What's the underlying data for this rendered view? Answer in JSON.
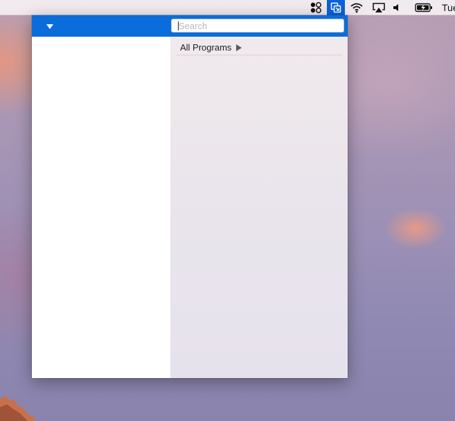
{
  "menubar": {
    "icons": [
      "control-center-icon",
      "switch-app-icon",
      "wifi-icon",
      "airplay-icon",
      "volume-icon",
      "battery-charging-icon"
    ],
    "clock": "Tue"
  },
  "popover": {
    "search": {
      "placeholder": "Search",
      "value": ""
    },
    "all_programs": {
      "label": "All Programs"
    }
  },
  "colors": {
    "header": "#0a6ddb",
    "active_menubar_item": "#0a63d8"
  }
}
